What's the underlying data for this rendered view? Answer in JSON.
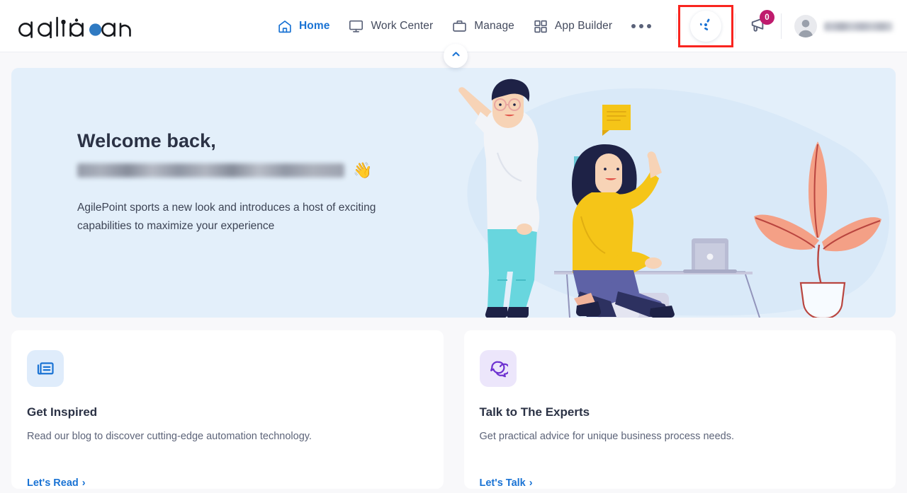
{
  "brand": {
    "logo_text": "agilepoint",
    "accent_blue": "#1a73d4",
    "logo_dot_color": "#2f7ac2"
  },
  "header": {
    "nav": [
      {
        "label": "Home",
        "icon": "home-icon",
        "active": true
      },
      {
        "label": "Work Center",
        "icon": "monitor-icon",
        "active": false
      },
      {
        "label": "Manage",
        "icon": "briefcase-icon",
        "active": false
      },
      {
        "label": "App Builder",
        "icon": "grid-icon",
        "active": false
      }
    ],
    "more_label": "More",
    "ai_assistant": {
      "icon": "ai-pinwheel-icon",
      "highlighted": true,
      "highlight_color": "#f9251f"
    },
    "announcements": {
      "icon": "megaphone-icon",
      "badge_count": "0",
      "badge_color": "#bf1b6d"
    },
    "user": {
      "avatar_icon": "user-avatar-icon",
      "name": "",
      "name_redacted": true
    },
    "collapse_button_icon": "chevron-up-icon"
  },
  "hero": {
    "greeting": "Welcome back,",
    "user_name": "",
    "user_name_redacted": true,
    "wave_emoji": "👋",
    "description": "AgilePoint sports a new look and introduces a host of exciting capabilities to maximize your experience",
    "background_color": "#e3effa",
    "illustration": "two-people-desk-illustration"
  },
  "cards": [
    {
      "icon": "newspaper-icon",
      "icon_theme": "blue",
      "title": "Get Inspired",
      "description": "Read our blog to discover cutting-edge automation technology.",
      "link_label": "Let's Read",
      "link_chevron": "›"
    },
    {
      "icon": "chat-bubbles-icon",
      "icon_theme": "purple",
      "title": "Talk to The Experts",
      "description": "Get practical advice for unique business process needs.",
      "link_label": "Let's Talk",
      "link_chevron": "›"
    }
  ]
}
